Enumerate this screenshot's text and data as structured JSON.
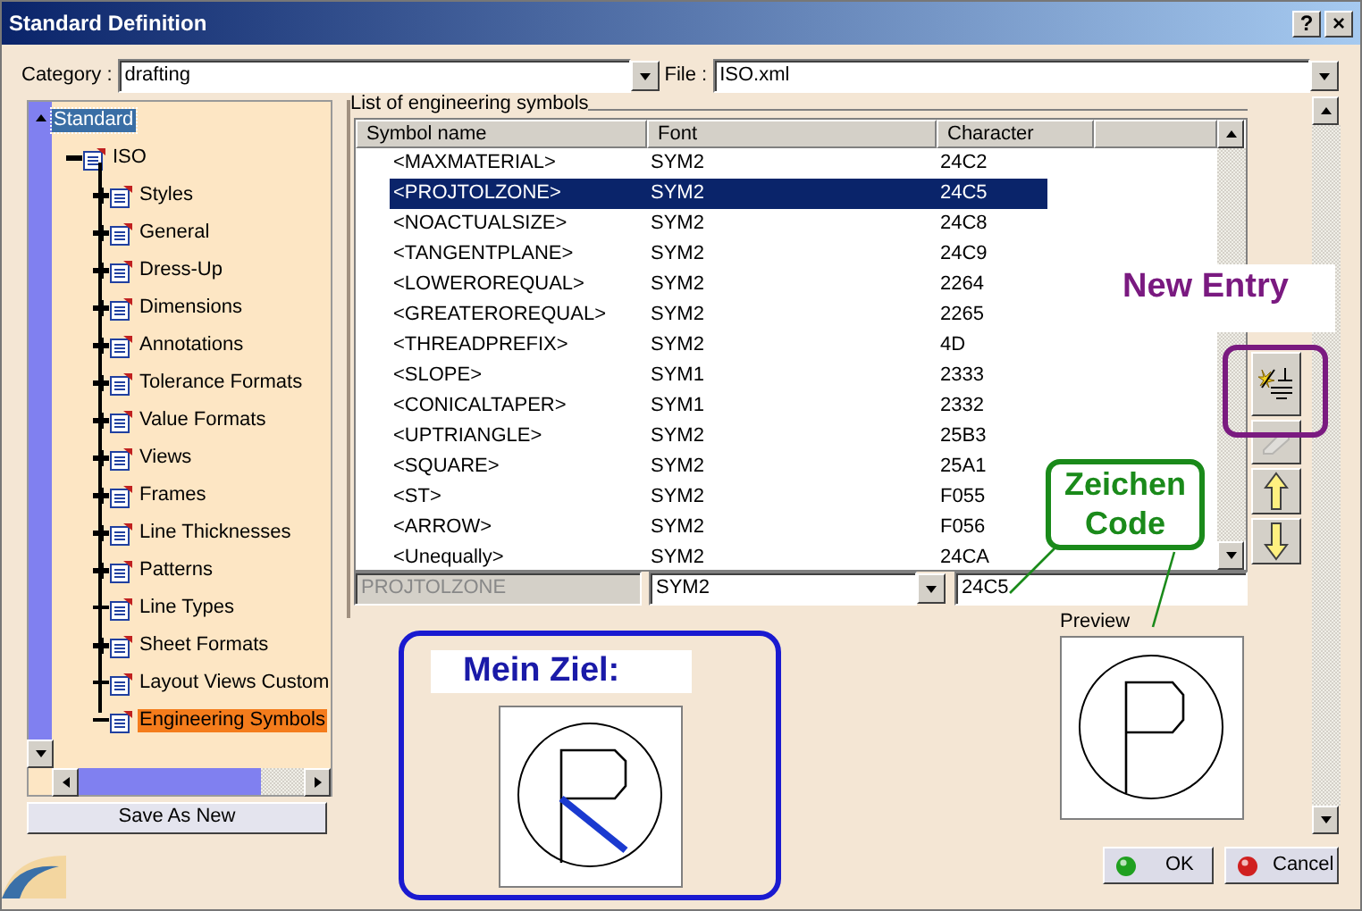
{
  "window": {
    "title": "Standard Definition",
    "help_button": "?",
    "close_button": "×"
  },
  "category": {
    "label": "Category :",
    "value": "drafting"
  },
  "file": {
    "label": "File :",
    "value": "ISO.xml"
  },
  "tree": {
    "label": "Standard",
    "focused": true,
    "children": [
      {
        "label": "ISO",
        "expanded": true,
        "children": [
          {
            "label": "Styles",
            "expandable": true,
            "selected": false
          },
          {
            "label": "General",
            "expandable": true,
            "selected": false
          },
          {
            "label": "Dress-Up",
            "expandable": true,
            "selected": false
          },
          {
            "label": "Dimensions",
            "expandable": true,
            "selected": false
          },
          {
            "label": "Annotations",
            "expandable": true,
            "selected": false
          },
          {
            "label": "Tolerance Formats",
            "expandable": true,
            "selected": false
          },
          {
            "label": "Value Formats",
            "expandable": true,
            "selected": false
          },
          {
            "label": "Views",
            "expandable": true,
            "selected": false
          },
          {
            "label": "Frames",
            "expandable": true,
            "selected": false
          },
          {
            "label": "Line Thicknesses",
            "expandable": true,
            "selected": false
          },
          {
            "label": "Patterns",
            "expandable": true,
            "selected": false
          },
          {
            "label": "Line Types",
            "expandable": false,
            "selected": false
          },
          {
            "label": "Sheet Formats",
            "expandable": true,
            "selected": false
          },
          {
            "label": "Layout Views Custom",
            "expandable": false,
            "selected": false
          },
          {
            "label": "Engineering Symbols",
            "expandable": false,
            "selected": true
          }
        ]
      }
    ]
  },
  "save_button": "Save As New",
  "symbols": {
    "title": "List of engineering symbols",
    "columns": [
      "Symbol name",
      "Font",
      "Character"
    ],
    "rows": [
      {
        "cells": [
          "<MAXMATERIAL>",
          "SYM2",
          "24C2"
        ],
        "selected": false
      },
      {
        "cells": [
          "<PROJTOLZONE>",
          "SYM2",
          "24C5"
        ],
        "selected": true
      },
      {
        "cells": [
          "<NOACTUALSIZE>",
          "SYM2",
          "24C8"
        ],
        "selected": false
      },
      {
        "cells": [
          "<TANGENTPLANE>",
          "SYM2",
          "24C9"
        ],
        "selected": false
      },
      {
        "cells": [
          "<LOWEROREQUAL>",
          "SYM2",
          "2264"
        ],
        "selected": false
      },
      {
        "cells": [
          "<GREATEROREQUAL>",
          "SYM2",
          "2265"
        ],
        "selected": false
      },
      {
        "cells": [
          "<THREADPREFIX>",
          "SYM2",
          "4D"
        ],
        "selected": false
      },
      {
        "cells": [
          "<SLOPE>",
          "SYM1",
          "2333"
        ],
        "selected": false
      },
      {
        "cells": [
          "<CONICALTAPER>",
          "SYM1",
          "2332"
        ],
        "selected": false
      },
      {
        "cells": [
          "<UPTRIANGLE>",
          "SYM2",
          "25B3"
        ],
        "selected": false
      },
      {
        "cells": [
          "<SQUARE>",
          "SYM2",
          "25A1"
        ],
        "selected": false
      },
      {
        "cells": [
          "<ST>",
          "SYM2",
          "F055"
        ],
        "selected": false
      },
      {
        "cells": [
          "<ARROW>",
          "SYM2",
          "F056"
        ],
        "selected": false
      },
      {
        "cells": [
          "<Unequally>",
          "SYM2",
          "24CA"
        ],
        "selected": false
      }
    ]
  },
  "editor": {
    "name": "PROJTOLZONE",
    "name_disabled": true,
    "font": "SYM2",
    "character": "24C5"
  },
  "toolbar": [
    {
      "kind": "new",
      "disabled": false
    },
    {
      "kind": "erase",
      "disabled": true
    },
    {
      "kind": "up",
      "disabled": false
    },
    {
      "kind": "down",
      "disabled": false
    }
  ],
  "preview": {
    "label": "Preview"
  },
  "buttons": [
    {
      "kind": "ok",
      "label": "OK"
    },
    {
      "kind": "cancel",
      "label": "Cancel"
    }
  ],
  "annotations": [
    {
      "kind": "goal",
      "text": "Mein Ziel:"
    },
    {
      "kind": "new_entry",
      "text": "New Entry"
    },
    {
      "kind": "code",
      "text": "Zeichen Code"
    }
  ]
}
